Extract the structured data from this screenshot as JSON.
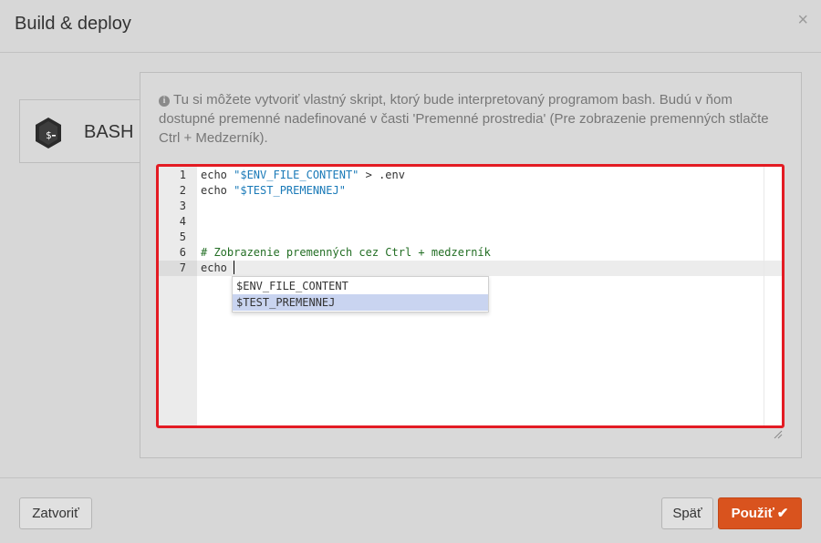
{
  "modal": {
    "title": "Build & deploy",
    "close_glyph": "×"
  },
  "tab": {
    "label": "BASH",
    "icon": "bash-terminal-icon"
  },
  "help": {
    "icon": "info-icon",
    "text": "Tu si môžete vytvoriť vlastný skript, ktorý bude interpretovaný programom bash. Budú v ňom dostupné premenné nadefinované v časti 'Premenné prostredia' (Pre zobrazenie premenných stlačte Ctrl + Medzerník)."
  },
  "editor": {
    "line_numbers": [
      "1",
      "2",
      "3",
      "4",
      "5",
      "6",
      "7"
    ],
    "lines": {
      "l1_cmd": "echo ",
      "l1_str": "\"$ENV_FILE_CONTENT\"",
      "l1_rest": " > .env",
      "l2_cmd": "echo ",
      "l2_str": "\"$TEST_PREMENNEJ\"",
      "l6_comment": "# Zobrazenie premenných cez Ctrl + medzerník",
      "l7_cmd": "echo "
    },
    "active_line": 7,
    "autocomplete": [
      "$ENV_FILE_CONTENT",
      "$TEST_PREMENNEJ"
    ],
    "autocomplete_selected": 1
  },
  "footer": {
    "close_label": "Zatvoriť",
    "back_label": "Späť",
    "apply_label": "Použiť",
    "apply_icon": "check-icon"
  },
  "colors": {
    "accent": "#d9531e",
    "editor_border": "#e31b23"
  }
}
